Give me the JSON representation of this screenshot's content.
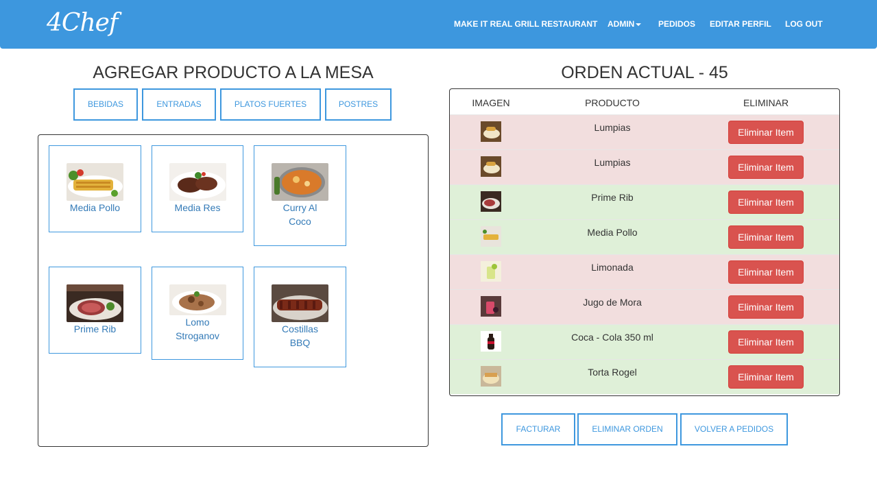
{
  "navbar": {
    "brand": "4Chef",
    "restaurant": "MAKE IT REAL GRILL RESTAURANT",
    "admin": "ADMIN",
    "pedidos": "PEDIDOS",
    "editar_perfil": "EDITAR PERFIL",
    "logout": "LOG OUT"
  },
  "left": {
    "heading": "AGREGAR PRODUCTO A LA MESA",
    "categories": [
      "BEBIDAS",
      "ENTRADAS",
      "PLATOS FUERTES",
      "POSTRES"
    ],
    "products": [
      {
        "line1": "Media Pollo",
        "line2": ""
      },
      {
        "line1": "Media Res",
        "line2": ""
      },
      {
        "line1": "Curry Al",
        "line2": "Coco"
      },
      {
        "line1": "Prime Rib",
        "line2": ""
      },
      {
        "line1": "Lomo",
        "line2": "Stroganov"
      },
      {
        "line1": "Costillas",
        "line2": "BBQ"
      }
    ]
  },
  "right": {
    "heading": "ORDEN ACTUAL - 45",
    "columns": [
      "IMAGEN",
      "PRODUCTO",
      "ELIMINAR"
    ],
    "remove_label": "Eliminar Item",
    "items": [
      {
        "name": "Lumpias",
        "status": "red"
      },
      {
        "name": "Lumpias",
        "status": "red"
      },
      {
        "name": "Prime Rib",
        "status": "green"
      },
      {
        "name": "Media Pollo",
        "status": "green"
      },
      {
        "name": "Limonada",
        "status": "red"
      },
      {
        "name": "Jugo de Mora",
        "status": "red"
      },
      {
        "name": "Coca - Cola 350 ml",
        "status": "green"
      },
      {
        "name": "Torta Rogel",
        "status": "green"
      }
    ],
    "actions": [
      "FACTURAR",
      "ELIMINAR ORDEN",
      "VOLVER A PEDIDOS"
    ]
  },
  "colors": {
    "primary": "#3d97de",
    "danger": "#d9534f",
    "row_red": "#f2dede",
    "row_green": "#dff0d8",
    "link": "#337ab7"
  }
}
